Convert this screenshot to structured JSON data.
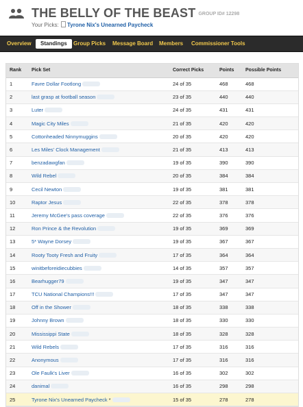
{
  "header": {
    "title": "THE BELLY OF THE BEAST",
    "group_id_label": "GROUP ID# 12298",
    "your_picks_label": "Your Picks:",
    "your_pick_name": "Tyrone Nix's Unearned Paycheck"
  },
  "nav": {
    "items": [
      {
        "label": "Overview",
        "active": false
      },
      {
        "label": "Standings",
        "active": true
      },
      {
        "label": "Group Picks",
        "active": false
      },
      {
        "label": "Message Board",
        "active": false
      },
      {
        "label": "Members",
        "active": false
      },
      {
        "label": "Commissioner Tools",
        "active": false
      }
    ]
  },
  "colors": {
    "nav_background": "#2b2b2b",
    "nav_text": "#f2c94c",
    "link": "#1f5fa6",
    "highlight_row": "#fcf6cf"
  },
  "icons": {
    "group": "group-people-icon",
    "picks": "document-icon"
  },
  "standings": {
    "columns": [
      "Rank",
      "Pick Set",
      "Correct Picks",
      "Points",
      "Possible Points"
    ],
    "rows": [
      {
        "rank": "1",
        "name": "Favre Dollar Footlong",
        "correct": "24 of 35",
        "points": "468",
        "possible": "468"
      },
      {
        "rank": "2",
        "name": "last grasp at football season",
        "correct": "23 of 35",
        "points": "440",
        "possible": "440"
      },
      {
        "rank": "3",
        "name": "Luter",
        "correct": "24 of 35",
        "points": "431",
        "possible": "431"
      },
      {
        "rank": "4",
        "name": "Magic City Miles",
        "correct": "21 of 35",
        "points": "420",
        "possible": "420"
      },
      {
        "rank": "5",
        "name": "Cottonheaded Ninnymuggins",
        "correct": "20 of 35",
        "points": "420",
        "possible": "420"
      },
      {
        "rank": "6",
        "name": "Les Miles' Clock Management",
        "correct": "21 of 35",
        "points": "413",
        "possible": "413"
      },
      {
        "rank": "7",
        "name": "benzadawgfan",
        "correct": "19 of 35",
        "points": "390",
        "possible": "390"
      },
      {
        "rank": "8",
        "name": "Wild Rebel",
        "correct": "20 of 35",
        "points": "384",
        "possible": "384"
      },
      {
        "rank": "9",
        "name": "Cecil Newton",
        "correct": "19 of 35",
        "points": "381",
        "possible": "381"
      },
      {
        "rank": "10",
        "name": "Raptor Jesus",
        "correct": "22 of 35",
        "points": "378",
        "possible": "378"
      },
      {
        "rank": "11",
        "name": "Jeremy McGee's pass coverage",
        "correct": "22 of 35",
        "points": "376",
        "possible": "376"
      },
      {
        "rank": "12",
        "name": "Ron Prince & the Revolution",
        "correct": "19 of 35",
        "points": "369",
        "possible": "369"
      },
      {
        "rank": "13",
        "name": "5* Wayne Dorsey",
        "correct": "19 of 35",
        "points": "367",
        "possible": "367"
      },
      {
        "rank": "14",
        "name": "Rooty Tooty Fresh and Fruity",
        "correct": "17 of 35",
        "points": "364",
        "possible": "364"
      },
      {
        "rank": "15",
        "name": "winitbeforeidiecubbies",
        "correct": "14 of 35",
        "points": "357",
        "possible": "357"
      },
      {
        "rank": "16",
        "name": "Bearhugger79",
        "correct": "19 of 35",
        "points": "347",
        "possible": "347"
      },
      {
        "rank": "17",
        "name": "TCU National Champions!!!",
        "correct": "17 of 35",
        "points": "347",
        "possible": "347"
      },
      {
        "rank": "18",
        "name": "Off in the Shower",
        "correct": "18 of 35",
        "points": "338",
        "possible": "338"
      },
      {
        "rank": "19",
        "name": "Johnny Brown",
        "correct": "18 of 35",
        "points": "330",
        "possible": "330"
      },
      {
        "rank": "20",
        "name": "Mississippi State",
        "correct": "18 of 35",
        "points": "328",
        "possible": "328"
      },
      {
        "rank": "21",
        "name": "Wild Rebels",
        "correct": "17 of 35",
        "points": "316",
        "possible": "316"
      },
      {
        "rank": "22",
        "name": "Anonymous",
        "correct": "17 of 35",
        "points": "316",
        "possible": "316"
      },
      {
        "rank": "23",
        "name": "Ole Faulk's Liver",
        "correct": "16 of 35",
        "points": "302",
        "possible": "302"
      },
      {
        "rank": "24",
        "name": "danimal",
        "correct": "16 of 35",
        "points": "298",
        "possible": "298"
      },
      {
        "rank": "25",
        "name": "Tyrone Nix's Unearned Paycheck",
        "correct": "15 of 35",
        "points": "278",
        "possible": "278",
        "mine": true
      }
    ]
  }
}
